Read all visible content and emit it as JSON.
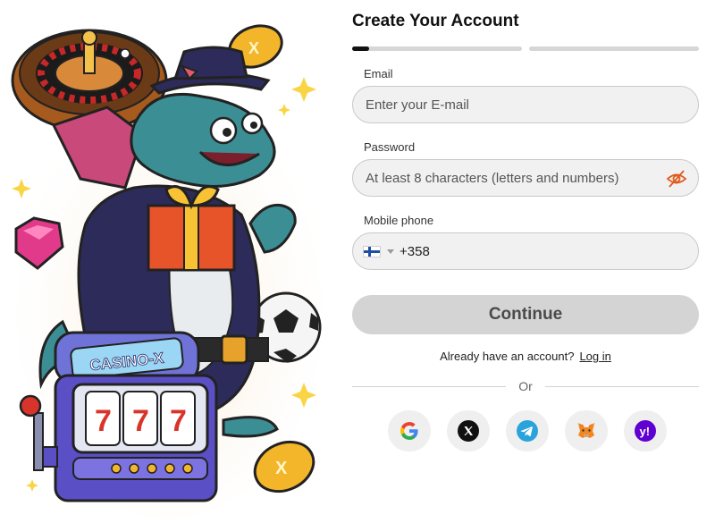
{
  "brand": {
    "slot_sign": "CASINO-X",
    "slot_digits": [
      "7",
      "7",
      "7"
    ]
  },
  "signup": {
    "title": "Create Your Account",
    "progress": {
      "steps": 2,
      "current_step": 1,
      "step1_fill_fraction": 0.1
    },
    "email": {
      "label": "Email",
      "placeholder": "Enter your E-mail"
    },
    "password": {
      "label": "Password",
      "placeholder": "At least 8 characters (letters and numbers)",
      "toggle_icon": "eye-off-icon"
    },
    "phone": {
      "label": "Mobile phone",
      "country_flag": "finland-flag-icon",
      "dial_code": "+358"
    },
    "continue_label": "Continue",
    "login_prompt": "Already have an account?",
    "login_link": "Log in",
    "divider_label": "Or",
    "socials": [
      "google-icon",
      "x-icon",
      "telegram-icon",
      "metamask-icon",
      "yahoo-icon"
    ]
  },
  "colors": {
    "accent_dark": "#111111",
    "eye_icon": "#e05a1a",
    "field_bg": "#f1f1f1",
    "button_disabled": "#d4d4d4"
  }
}
